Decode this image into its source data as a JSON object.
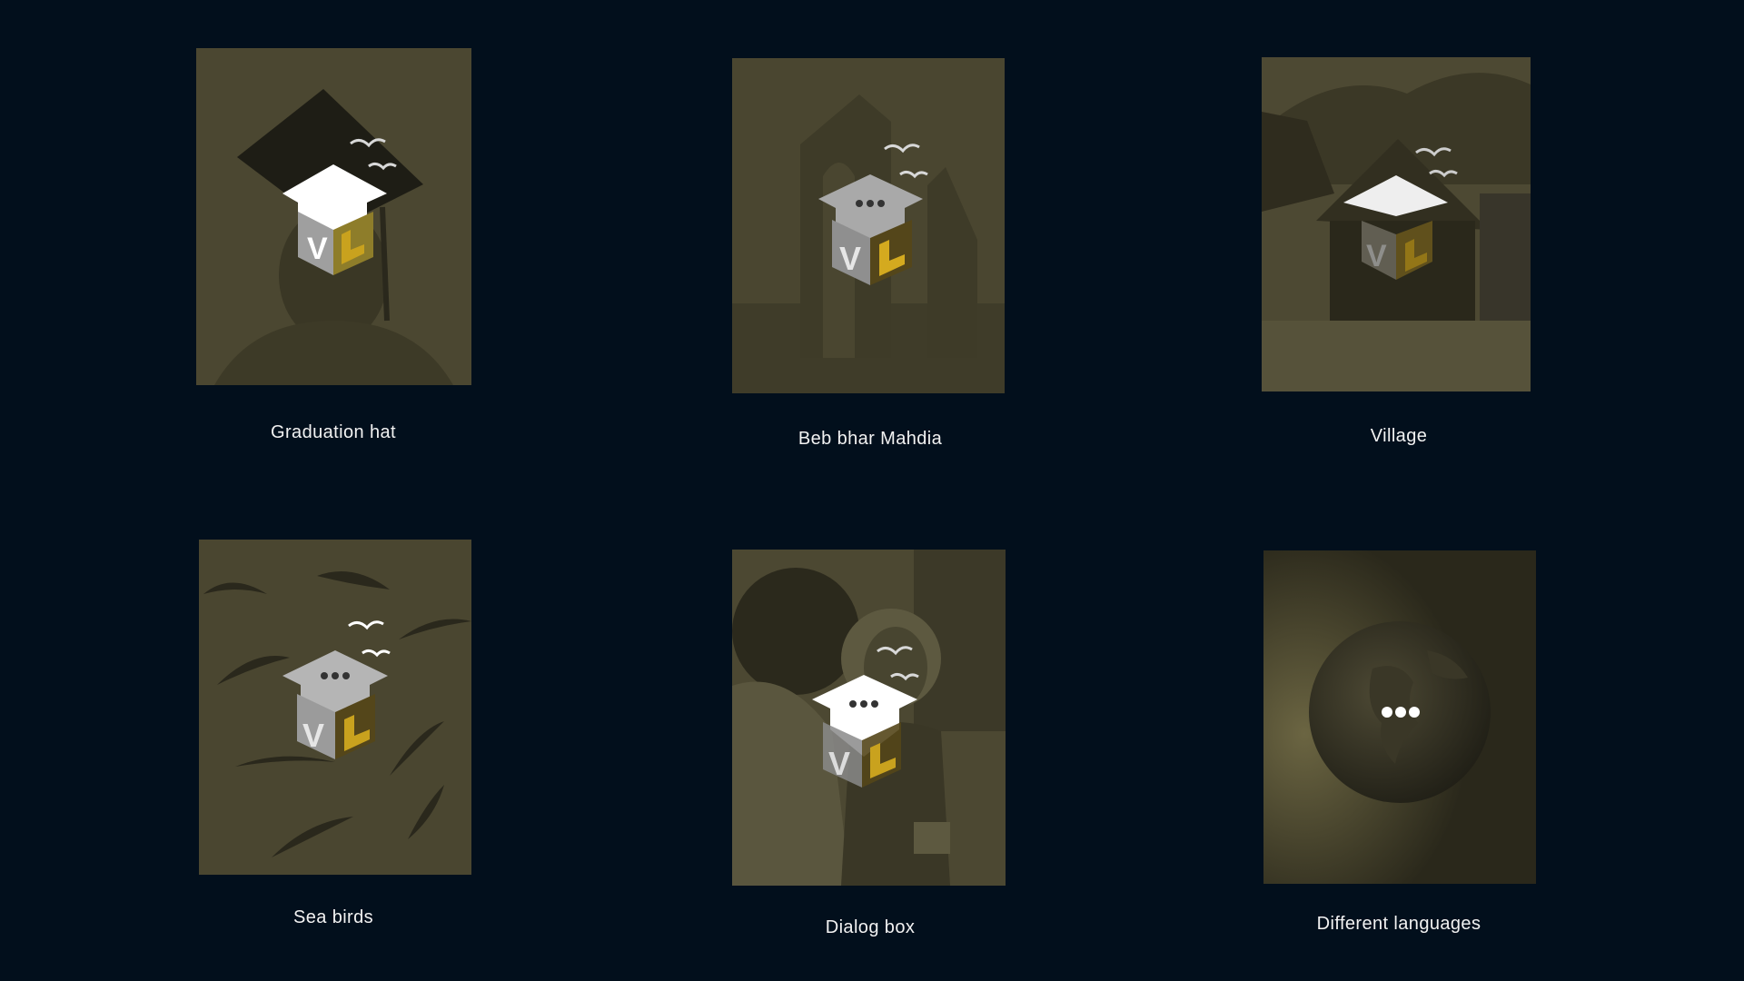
{
  "colors": {
    "background": "#020f1c",
    "tint": "#4a4630",
    "logo_gold": "#c9a21e",
    "logo_gray": "#a8a8a8",
    "caption": "#f2f2f2"
  },
  "cards": [
    {
      "caption": "Graduation hat",
      "image_icon": "graduation-hat-photo"
    },
    {
      "caption": "Beb bhar Mahdia",
      "image_icon": "ruin-arch-photo"
    },
    {
      "caption": "Village",
      "image_icon": "thatched-village-photo"
    },
    {
      "caption": "Sea birds",
      "image_icon": "sea-birds-photo"
    },
    {
      "caption": "Dialog box",
      "image_icon": "conversation-photo"
    },
    {
      "caption": "Different languages",
      "image_icon": "earth-globe-photo"
    }
  ]
}
